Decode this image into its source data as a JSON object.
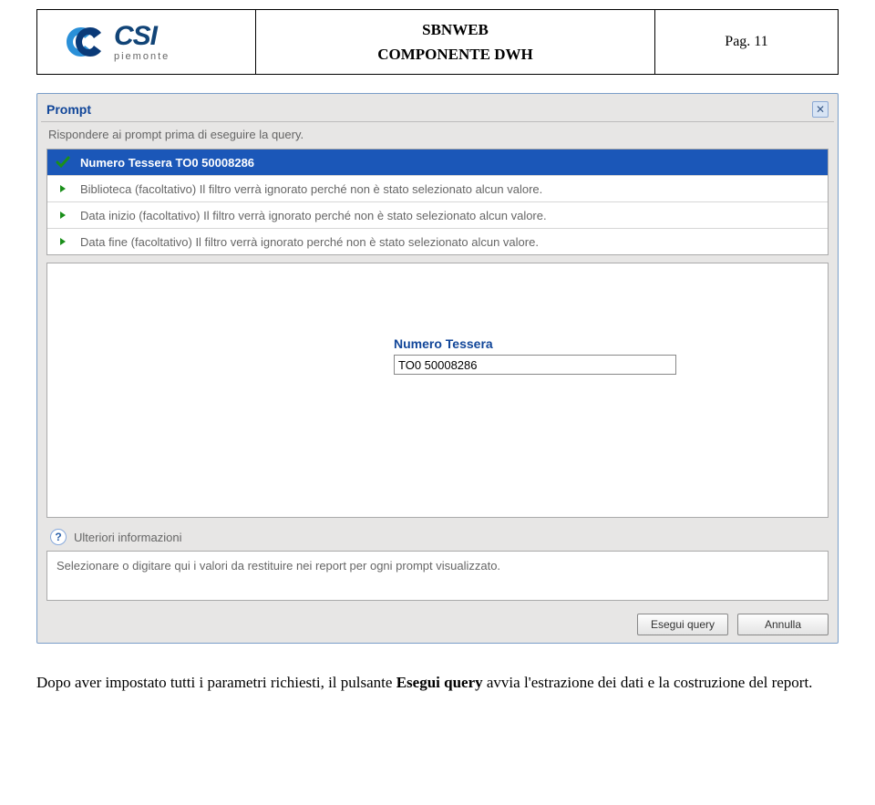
{
  "header": {
    "logo": {
      "name": "CSI",
      "sub": "piemonte"
    },
    "title_line1": "SBNWEB",
    "title_line2": "COMPONENTE DWH",
    "page_label": "Pag. 11"
  },
  "dialog": {
    "title": "Prompt",
    "instruction": "Rispondere ai prompt prima di eseguire la query.",
    "prompts": [
      {
        "label": "Numero Tessera TO0 50008286",
        "selected": true
      },
      {
        "label": "Biblioteca (facoltativo) Il filtro verrà ignorato perché non è stato selezionato alcun valore.",
        "selected": false
      },
      {
        "label": "Data inizio (facoltativo) Il filtro verrà ignorato perché non è stato selezionato alcun valore.",
        "selected": false
      },
      {
        "label": "Data fine (facoltativo) Il filtro verrà ignorato perché non è stato selezionato alcun valore.",
        "selected": false
      }
    ],
    "field": {
      "label": "Numero Tessera",
      "value": "TO0 50008286"
    },
    "more_info_label": "Ulteriori informazioni",
    "hint": "Selezionare o digitare qui i valori da restituire nei report per ogni prompt visualizzato.",
    "buttons": {
      "run": "Esegui query",
      "cancel": "Annulla"
    }
  },
  "caption": {
    "prefix": "Dopo aver impostato tutti i parametri richiesti, il pulsante ",
    "bold": "Esegui query",
    "suffix": " avvia l'estrazione dei dati e la costruzione del report."
  }
}
